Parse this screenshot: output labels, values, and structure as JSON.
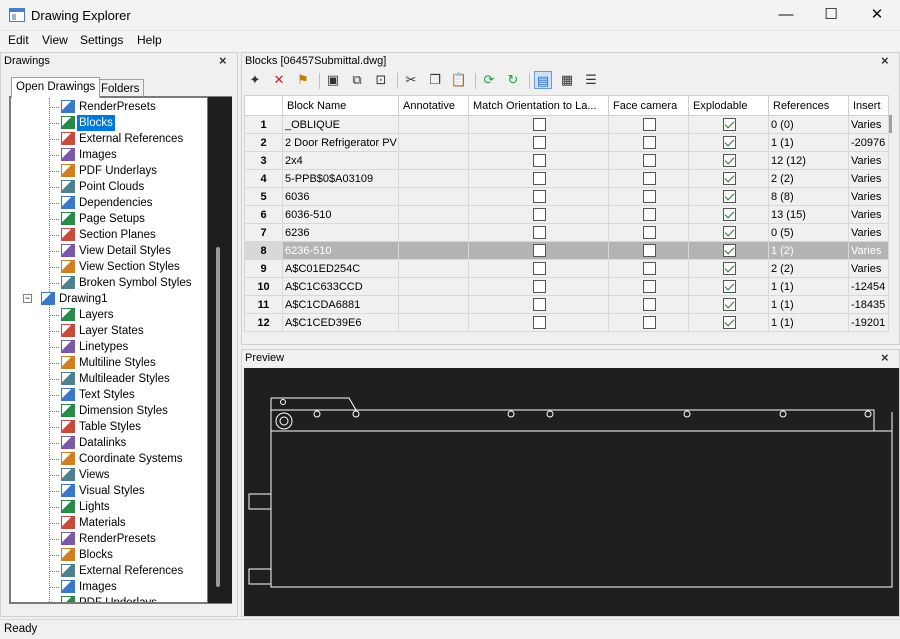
{
  "window": {
    "title": "Drawing Explorer",
    "minimize": "—",
    "maximize": "☐",
    "close": "✕"
  },
  "menu": [
    "Edit",
    "View",
    "Settings",
    "Help"
  ],
  "left_panel": {
    "title": "Drawings",
    "close": "×",
    "tabs": [
      "Open Drawings",
      "Folders"
    ],
    "tree": [
      {
        "label": "RenderPresets",
        "icon": "render-presets-icon",
        "level": 2
      },
      {
        "label": "Blocks",
        "icon": "blocks-icon",
        "level": 2,
        "selected": true
      },
      {
        "label": "External References",
        "icon": "external-references-icon",
        "level": 2
      },
      {
        "label": "Images",
        "icon": "images-icon",
        "level": 2
      },
      {
        "label": "PDF Underlays",
        "icon": "pdf-underlays-icon",
        "level": 2
      },
      {
        "label": "Point Clouds",
        "icon": "point-clouds-icon",
        "level": 2
      },
      {
        "label": "Dependencies",
        "icon": "dependencies-icon",
        "level": 2
      },
      {
        "label": "Page Setups",
        "icon": "page-setups-icon",
        "level": 2
      },
      {
        "label": "Section Planes",
        "icon": "section-planes-icon",
        "level": 2
      },
      {
        "label": "View Detail Styles",
        "icon": "view-detail-styles-icon",
        "level": 2
      },
      {
        "label": "View Section Styles",
        "icon": "view-section-styles-icon",
        "level": 2
      },
      {
        "label": "Broken Symbol Styles",
        "icon": "broken-symbol-styles-icon",
        "level": 2
      },
      {
        "label": "Drawing1",
        "icon": "drawing-icon",
        "level": 1,
        "expander": "−"
      },
      {
        "label": "Layers",
        "icon": "layers-icon",
        "level": 2
      },
      {
        "label": "Layer States",
        "icon": "layer-states-icon",
        "level": 2
      },
      {
        "label": "Linetypes",
        "icon": "linetypes-icon",
        "level": 2
      },
      {
        "label": "Multiline Styles",
        "icon": "multiline-styles-icon",
        "level": 2
      },
      {
        "label": "Multileader Styles",
        "icon": "multileader-styles-icon",
        "level": 2
      },
      {
        "label": "Text Styles",
        "icon": "text-styles-icon",
        "level": 2
      },
      {
        "label": "Dimension Styles",
        "icon": "dimension-styles-icon",
        "level": 2
      },
      {
        "label": "Table Styles",
        "icon": "table-styles-icon",
        "level": 2
      },
      {
        "label": "Datalinks",
        "icon": "datalinks-icon",
        "level": 2
      },
      {
        "label": "Coordinate Systems",
        "icon": "coordinate-systems-icon",
        "level": 2
      },
      {
        "label": "Views",
        "icon": "views-icon",
        "level": 2
      },
      {
        "label": "Visual Styles",
        "icon": "visual-styles-icon",
        "level": 2
      },
      {
        "label": "Lights",
        "icon": "lights-icon",
        "level": 2
      },
      {
        "label": "Materials",
        "icon": "materials-icon",
        "level": 2
      },
      {
        "label": "RenderPresets",
        "icon": "render-presets-icon",
        "level": 2
      },
      {
        "label": "Blocks",
        "icon": "blocks-icon",
        "level": 2
      },
      {
        "label": "External References",
        "icon": "external-references-icon",
        "level": 2
      },
      {
        "label": "Images",
        "icon": "images-icon",
        "level": 2
      },
      {
        "label": "PDF Underlays",
        "icon": "pdf-underlays-icon",
        "level": 2
      }
    ]
  },
  "blocks_panel": {
    "title": "Blocks [06457Submittal.dwg]",
    "close": "×",
    "toolbar": [
      "new-icon",
      "delete-icon",
      "purge-icon",
      "insert-block-icon",
      "insert-icon",
      "copy-to-icon",
      "cut-icon",
      "copy-icon",
      "paste-icon",
      "refresh-icon",
      "reload-icon",
      "table-view-icon",
      "icon-view-icon",
      "tree-view-icon"
    ],
    "columns": [
      "Block Name",
      "Annotative",
      "Match Orientation to La...",
      "Face camera",
      "Explodable",
      "References",
      "Insert"
    ],
    "rows": [
      {
        "num": "1",
        "name": "_OBLIQUE",
        "annotative": "",
        "match": false,
        "face": false,
        "explodable": true,
        "refs": "0 (0)",
        "insert": "Varies"
      },
      {
        "num": "2",
        "name": "2 Door Refrigerator PV",
        "annotative": "",
        "match": false,
        "face": false,
        "explodable": true,
        "refs": "1 (1)",
        "insert": "-20976"
      },
      {
        "num": "3",
        "name": "2x4",
        "annotative": "",
        "match": false,
        "face": false,
        "explodable": true,
        "refs": "12 (12)",
        "insert": "Varies"
      },
      {
        "num": "4",
        "name": "5-PPB$0$A03109",
        "annotative": "",
        "match": false,
        "face": false,
        "explodable": true,
        "refs": "2 (2)",
        "insert": "Varies"
      },
      {
        "num": "5",
        "name": "6036",
        "annotative": "",
        "match": false,
        "face": false,
        "explodable": true,
        "refs": "8 (8)",
        "insert": "Varies"
      },
      {
        "num": "6",
        "name": "6036-510",
        "annotative": "",
        "match": false,
        "face": false,
        "explodable": true,
        "refs": "13 (15)",
        "insert": "Varies"
      },
      {
        "num": "7",
        "name": "6236",
        "annotative": "",
        "match": false,
        "face": false,
        "explodable": true,
        "refs": "0 (5)",
        "insert": "Varies"
      },
      {
        "num": "8",
        "name": "6236-510",
        "annotative": "",
        "match": false,
        "face": false,
        "explodable": true,
        "refs": "1 (2)",
        "insert": "Varies",
        "selected": true
      },
      {
        "num": "9",
        "name": "A$C01ED254C",
        "annotative": "",
        "match": false,
        "face": false,
        "explodable": true,
        "refs": "2 (2)",
        "insert": "Varies"
      },
      {
        "num": "10",
        "name": "A$C1C633CCD",
        "annotative": "",
        "match": false,
        "face": false,
        "explodable": true,
        "refs": "1 (1)",
        "insert": "-12454"
      },
      {
        "num": "11",
        "name": "A$C1CDA6881",
        "annotative": "",
        "match": false,
        "face": false,
        "explodable": true,
        "refs": "1 (1)",
        "insert": "-18435"
      },
      {
        "num": "12",
        "name": "A$C1CED39E6",
        "annotative": "",
        "match": false,
        "face": false,
        "explodable": true,
        "refs": "1 (1)",
        "insert": "-19201"
      }
    ]
  },
  "preview_panel": {
    "title": "Preview",
    "close": "×"
  },
  "status": "Ready"
}
